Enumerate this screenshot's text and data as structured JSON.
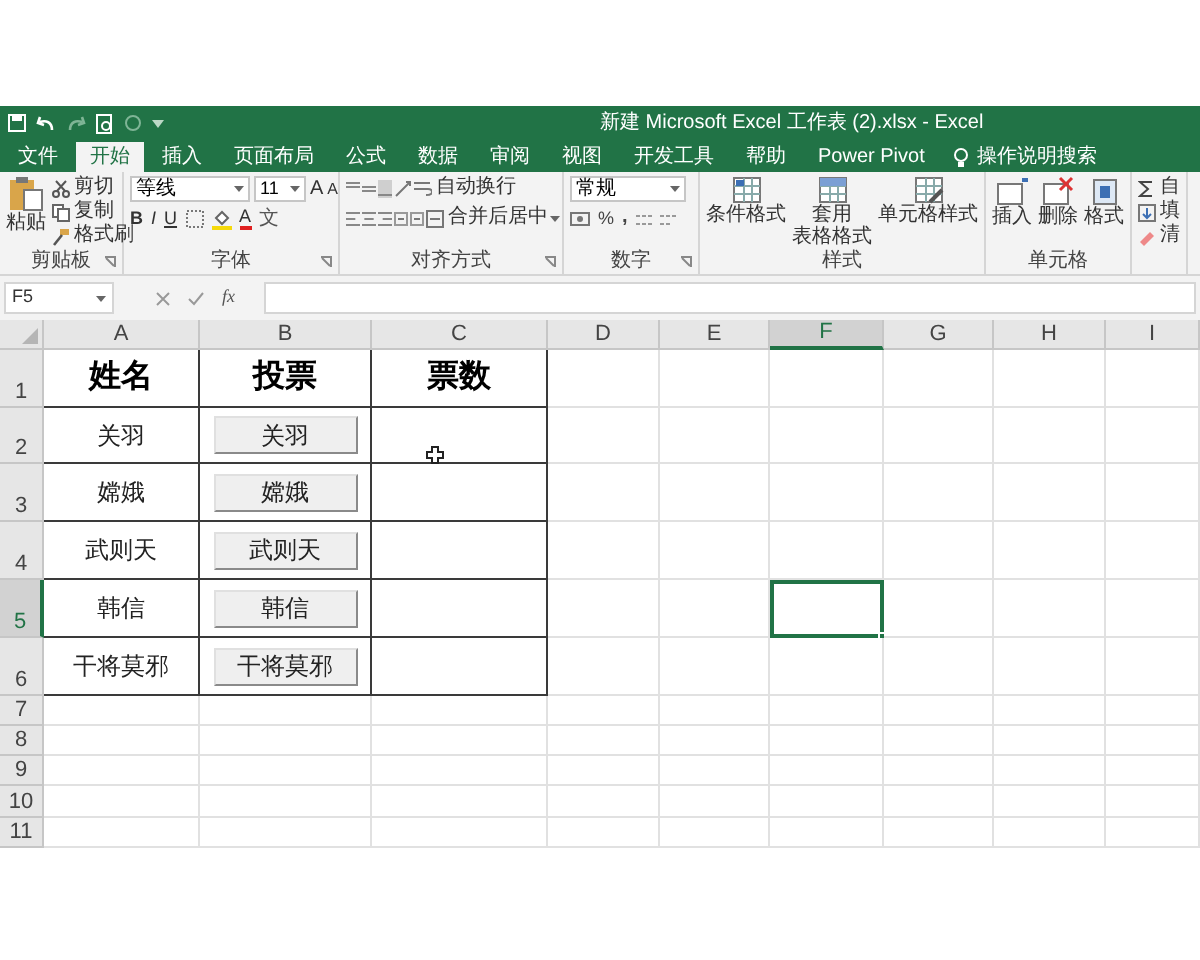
{
  "title_bar": {
    "title": "新建 Microsoft Excel 工作表 (2).xlsx - Excel"
  },
  "tabs": [
    {
      "label": "文件",
      "selected": false
    },
    {
      "label": "开始",
      "selected": true
    },
    {
      "label": "插入",
      "selected": false
    },
    {
      "label": "页面布局",
      "selected": false
    },
    {
      "label": "公式",
      "selected": false
    },
    {
      "label": "数据",
      "selected": false
    },
    {
      "label": "审阅",
      "selected": false
    },
    {
      "label": "视图",
      "selected": false
    },
    {
      "label": "开发工具",
      "selected": false
    },
    {
      "label": "帮助",
      "selected": false
    },
    {
      "label": "Power Pivot",
      "selected": false
    }
  ],
  "search": {
    "label": "操作说明搜索"
  },
  "ribbon": {
    "clipboard": {
      "label": "剪贴板",
      "paste": "粘贴",
      "cut": "剪切",
      "copy": "复制",
      "format_painter": "格式刷"
    },
    "font": {
      "label": "字体",
      "font_name": "等线",
      "font_size": "11",
      "grow": "A",
      "shrink": "A",
      "bold": "B",
      "italic": "I",
      "underline": "U",
      "font_color": "A",
      "phonetic": "文"
    },
    "alignment": {
      "label": "对齐方式",
      "wrap": "自动换行",
      "merge": "合并后居中"
    },
    "number": {
      "label": "数字",
      "format": "常规",
      "percent": "%",
      "comma": ","
    },
    "styles": {
      "label": "样式",
      "conditional": [
        "条件格式"
      ],
      "table": [
        "套用",
        "表格格式"
      ],
      "cell": [
        "单元格样式"
      ]
    },
    "cells": {
      "label": "单元格",
      "items": [
        "插入",
        "删除",
        "格式"
      ]
    },
    "editing": {
      "items": [
        "自",
        "填",
        "清"
      ]
    }
  },
  "formula_bar": {
    "name_box": "F5",
    "fx": "fx"
  },
  "column_headers": [
    {
      "label": "A",
      "selected": false
    },
    {
      "label": "B",
      "selected": false
    },
    {
      "label": "C",
      "selected": false
    },
    {
      "label": "D",
      "selected": false
    },
    {
      "label": "E",
      "selected": false
    },
    {
      "label": "F",
      "selected": true
    },
    {
      "label": "G",
      "selected": false
    },
    {
      "label": "H",
      "selected": false
    },
    {
      "label": "I",
      "selected": false
    }
  ],
  "row_headers": [
    {
      "label": "1",
      "selected": false
    },
    {
      "label": "2",
      "selected": false
    },
    {
      "label": "3",
      "selected": false
    },
    {
      "label": "4",
      "selected": false
    },
    {
      "label": "5",
      "selected": true
    },
    {
      "label": "6",
      "selected": false
    },
    {
      "label": "7",
      "selected": false
    },
    {
      "label": "8",
      "selected": false
    },
    {
      "label": "9",
      "selected": false
    },
    {
      "label": "10",
      "selected": false
    },
    {
      "label": "11",
      "selected": false
    }
  ],
  "table": {
    "columns": [
      "姓名",
      "投票",
      "票数"
    ],
    "rows": [
      {
        "name": "关羽",
        "vote_button": "关羽"
      },
      {
        "name": "嫦娥",
        "vote_button": "嫦娥"
      },
      {
        "name": "武则天",
        "vote_button": "武则天"
      },
      {
        "name": "韩信",
        "vote_button": "韩信"
      },
      {
        "name": "干将莫邪",
        "vote_button": "干将莫邪"
      }
    ]
  }
}
